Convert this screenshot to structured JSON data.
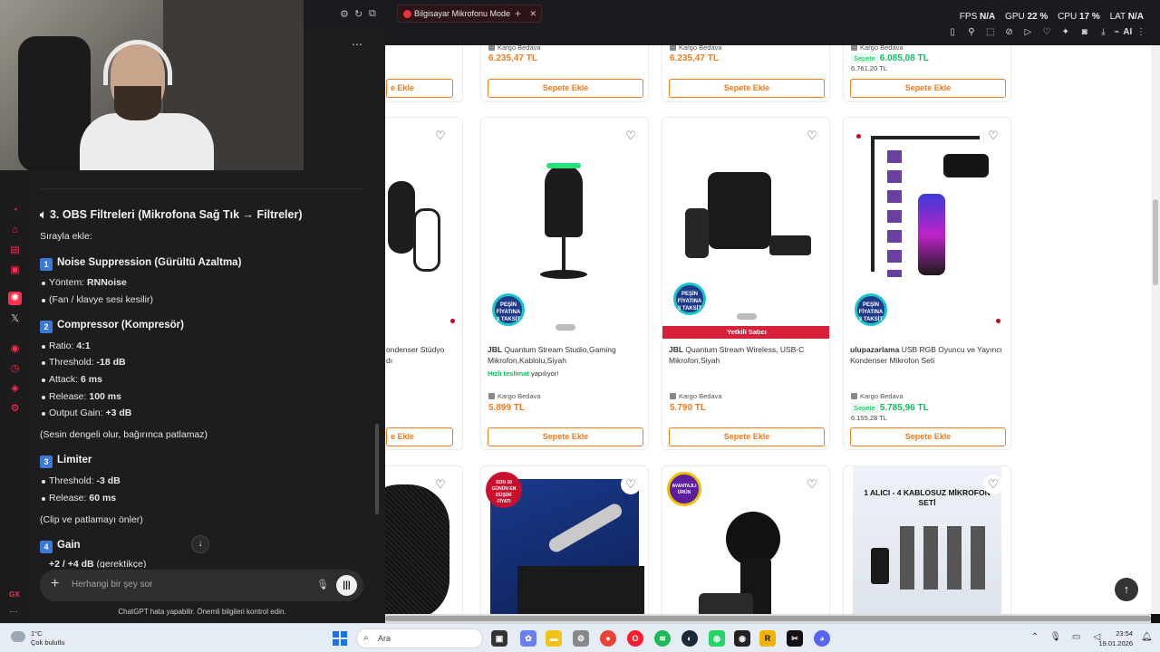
{
  "browser": {
    "tab_title": "Bilgisayar Mikrofonu Mode",
    "stats": {
      "fps_label": "FPS",
      "fps": "N/A",
      "gpu_label": "GPU",
      "gpu": "22 %",
      "cpu_label": "CPU",
      "cpu": "17 %",
      "lat_label": "LAT",
      "lat": "N/A"
    },
    "ai_label": "AI"
  },
  "chat": {
    "section_title": "3. OBS Filtreleri (Mikrofona Sağ Tık → Filtreler)",
    "intro": "Sırayla ekle:",
    "filters": [
      {
        "num": "1",
        "title": "Noise Suppression (Gürültü Azaltma)"
      },
      {
        "num": "2",
        "title": "Compressor (Kompresör)"
      },
      {
        "num": "3",
        "title": "Limiter"
      },
      {
        "num": "4",
        "title": "Gain"
      }
    ],
    "noise": {
      "method_label": "Yöntem: ",
      "method_value": "RNNoise",
      "note": "(Fan / klavye sesi kesilir)"
    },
    "compressor": {
      "ratio_label": "Ratio: ",
      "ratio": "4:1",
      "threshold_label": "Threshold: ",
      "threshold": "-18 dB",
      "attack_label": "Attack: ",
      "attack": "6 ms",
      "release_label": "Release: ",
      "release": "100 ms",
      "output_label": "Output Gain: ",
      "output": "+3 dB",
      "note": "(Sesin dengeli olur, bağırınca patlamaz)"
    },
    "limiter": {
      "threshold_label": "Threshold: ",
      "threshold": "-3 dB",
      "release_label": "Release: ",
      "release": "60 ms",
      "note": "(Clip ve patlamayı önler)"
    },
    "gain": {
      "value": "+2 / +4 dB",
      "suffix": " (gerektikçe)"
    },
    "placeholder": "Herhangi bir şey sor",
    "disclaimer": "ChatGPT hata yapabilir. Önemli bilgileri kontrol edin."
  },
  "products": {
    "button_label": "Sepete Ekle",
    "partial_button_label": "e Ekle",
    "kargo": "Kargo Bedava",
    "row1": [
      {
        "price": "6.235,47 TL"
      },
      {
        "price": "6.235,47 TL"
      },
      {
        "sepete": "Sepete",
        "price": "6.085,08 TL",
        "old_price": "6.761,20 TL"
      }
    ],
    "row2": [
      {
        "partial_title": "ondenser Stüdyo",
        "partial_title2": "dı"
      },
      {
        "brand": "JBL",
        "title": " Quantum Stream Studio,Gaming Mikrofon,Kablolu,Siyah",
        "fast_a": "Hızlı teslimat",
        "fast_b": " yapılıyor!",
        "price": "5.899 TL"
      },
      {
        "brand": "JBL",
        "title": " Quantum Stream Wireless, USB-C Mikrofon,Siyah",
        "yetkili": "Yetkili Satıcı",
        "price": "5.790 TL"
      },
      {
        "brand": "ulupazarlama",
        "title": " USB RGB Oyuncu ve Yayıncı Kondenser Mikrofon Seti",
        "sepete": "Sepete",
        "price": "5.785,96 TL",
        "old_price": "6.155,28 TL"
      }
    ],
    "badge_text": "PEŞİN FİYATINA 3 TAKSİT",
    "row3": {
      "son_badge": "SON 10 GÜNÜN EN DÜŞÜK FİYATI",
      "avantajli": "AVANTAJLI ÜRÜN",
      "banner_title": "1 ALICI - 4 KABLOSUZ MİKROFON SETİ"
    }
  },
  "taskbar": {
    "temp": "1°C",
    "weather": "Çok bulutlu",
    "search": "Ara",
    "time": "23:54",
    "date": "19.01.2026"
  }
}
